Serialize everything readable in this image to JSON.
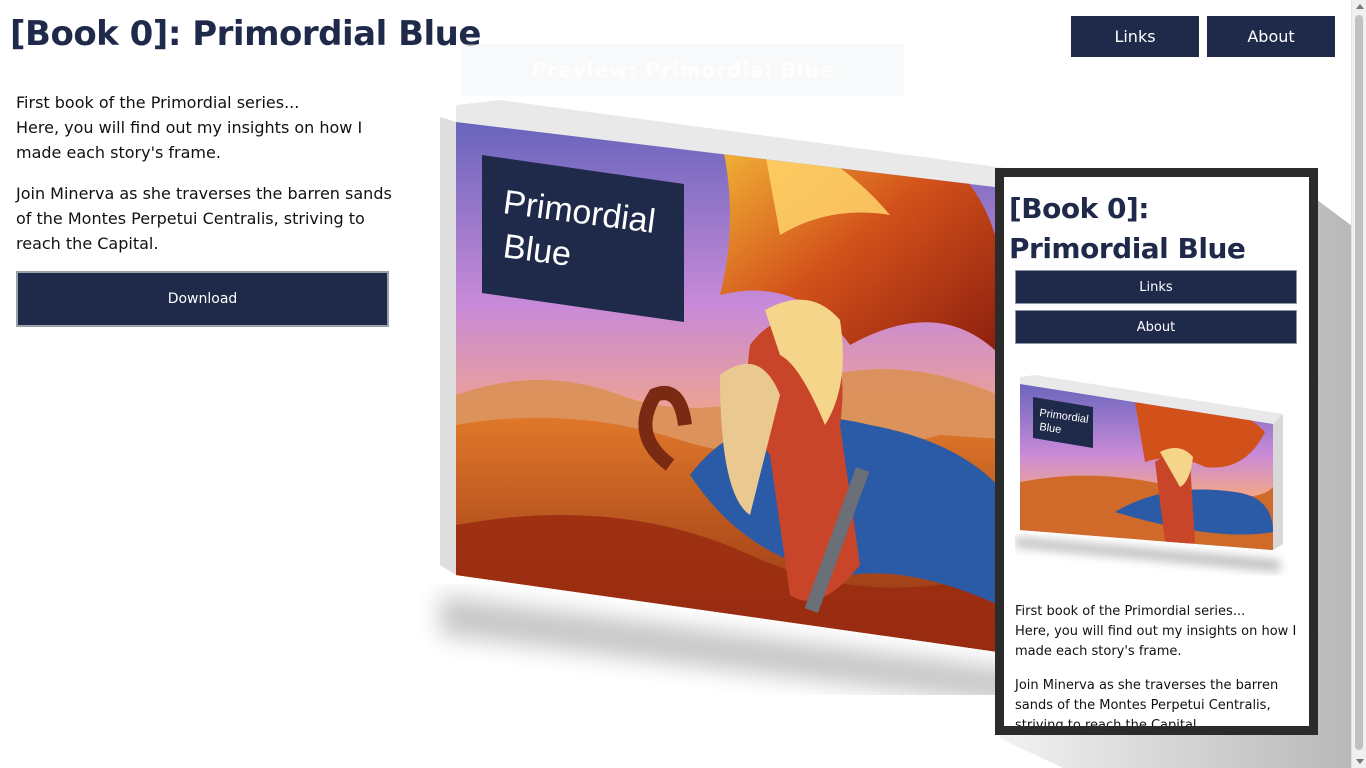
{
  "header": {
    "title": "[Book 0]: Primordial Blue",
    "nav": {
      "links_label": "Links",
      "about_label": "About"
    }
  },
  "intro": {
    "paragraph1_line1": "First book of the Primordial series...",
    "paragraph1_line2": "Here, you will find out my insights on how I made each story's frame.",
    "paragraph2": "Join Minerva as she traverses the barren sands of the Montes Perpetui Centralis, striving to reach the Capital.",
    "download_label": "Download"
  },
  "cover": {
    "title_line1": "Primordial",
    "title_line2": "Blue",
    "ghost_caption": "Preview: Primordial Blue"
  },
  "mobile_preview": {
    "title": "[Book 0]: Primordial Blue",
    "links_label": "Links",
    "about_label": "About",
    "cover_title_line1": "Primordial",
    "cover_title_line2": "Blue",
    "paragraph1_line1": "First book of the Primordial series...",
    "paragraph1_line2": "Here, you will find out my insights on how I made each story's frame.",
    "paragraph2": "Join Minerva as she traverses the barren sands of the Montes Perpetui Centralis, striving to reach the Capital."
  },
  "colors": {
    "brand_navy": "#1f2a4a",
    "frame_dark": "#2b2b2b"
  }
}
